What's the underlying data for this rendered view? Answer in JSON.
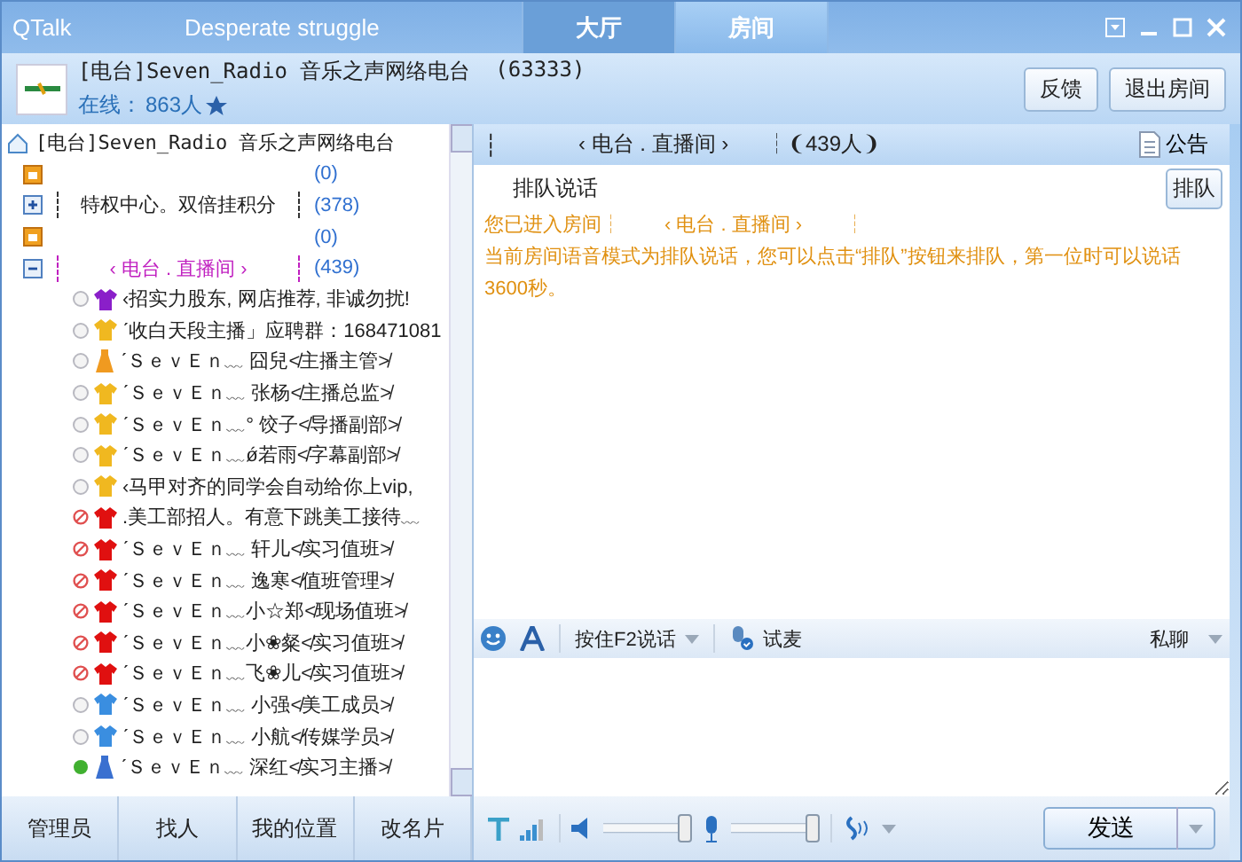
{
  "window": {
    "app": "QTalk",
    "user": "Desperate struggle",
    "tabs": [
      {
        "label": "大厅",
        "selected": false
      },
      {
        "label": "房间",
        "selected": true
      }
    ]
  },
  "header": {
    "title": "[电台]Seven_Radio 音乐之声网络电台",
    "id": "(63333)",
    "online_label": "在线：",
    "online_count": "863人",
    "buttons": [
      "反馈",
      "退出房间"
    ]
  },
  "tree": {
    "root": "[电台]Seven_Radio 音乐之声网络电台",
    "channels": [
      {
        "kind": "locked",
        "count": "(0)"
      },
      {
        "kind": "folder",
        "name": "特权中心。双倍挂积分",
        "count": "(378)",
        "expanded": false
      },
      {
        "kind": "locked",
        "count": "(0)"
      },
      {
        "kind": "folder",
        "name": "‹ 电台 . 直播间 ›",
        "count": "(439)",
        "expanded": true,
        "children": [
          {
            "name": "‹招实力股东, 网店推荐, 非诚勿扰!",
            "online": false,
            "blocked": false,
            "kind": "shirt",
            "color": "#8a1fc9"
          },
          {
            "name": "ˊ收白天段主播」应聘群：168471081",
            "online": false,
            "blocked": false,
            "kind": "shirt",
            "color": "#f0b820"
          },
          {
            "name": "ˊＳｅｖＥｎ﹏  囧兒≮主播主管≯",
            "online": false,
            "blocked": false,
            "kind": "dress",
            "color": "#f09a20"
          },
          {
            "name": "ˊＳｅｖＥｎ﹏  张杨≮主播总监≯",
            "online": false,
            "blocked": false,
            "kind": "shirt",
            "color": "#f0b820"
          },
          {
            "name": "ˊＳｅｖＥｎ﹏° 饺子≮导播副部≯",
            "online": false,
            "blocked": false,
            "kind": "shirt",
            "color": "#f0b820"
          },
          {
            "name": "ˊＳｅｖＥｎ﹏ǿ若雨≮字幕副部≯",
            "online": false,
            "blocked": false,
            "kind": "shirt",
            "color": "#f0b820"
          },
          {
            "name": "‹马甲对齐的同学会自动给你上vip,",
            "online": false,
            "blocked": false,
            "kind": "shirt",
            "color": "#f0b820"
          },
          {
            "name": ".美工部招人。有意下跳美工接待﹏",
            "online": false,
            "blocked": true,
            "kind": "shirt",
            "color": "#e01010"
          },
          {
            "name": "ˊＳｅｖＥｎ﹏  轩儿≮实习值班≯",
            "online": false,
            "blocked": true,
            "kind": "shirt",
            "color": "#e01010"
          },
          {
            "name": "ˊＳｅｖＥｎ﹏  逸寒≮值班管理≯",
            "online": false,
            "blocked": true,
            "kind": "shirt",
            "color": "#e01010"
          },
          {
            "name": "ˊＳｅｖＥｎ﹏小☆郑≮现场值班≯",
            "online": false,
            "blocked": true,
            "kind": "shirt",
            "color": "#e01010"
          },
          {
            "name": "ˊＳｅｖＥｎ﹏小❀粲≮实习值班≯",
            "online": false,
            "blocked": true,
            "kind": "shirt",
            "color": "#e01010"
          },
          {
            "name": "ˊＳｅｖＥｎ﹏飞❀儿≮实习值班≯",
            "online": false,
            "blocked": true,
            "kind": "shirt",
            "color": "#e01010"
          },
          {
            "name": "ˊＳｅｖＥｎ﹏  小强≮美工成员≯",
            "online": false,
            "blocked": false,
            "kind": "shirt",
            "color": "#3a8ee0"
          },
          {
            "name": "ˊＳｅｖＥｎ﹏  小航≮传媒学员≯",
            "online": false,
            "blocked": false,
            "kind": "shirt",
            "color": "#3a8ee0"
          },
          {
            "name": "ˊＳｅｖＥｎ﹏  深红≮实习主播≯",
            "online": true,
            "blocked": false,
            "kind": "dress",
            "color": "#3a70d0"
          }
        ]
      }
    ]
  },
  "left_buttons": [
    "管理员",
    "找人",
    "我的位置",
    "改名片"
  ],
  "room": {
    "prefix": "┆",
    "name": "‹ 电台 . 直播间 ›",
    "count": "┆❨439人❩",
    "notice": "公告",
    "mode": "排队说话",
    "queue_button": "排队",
    "messages": [
      "您已进入房间┆        ‹ 电台 . 直播间 ›        ┆",
      "当前房间语音模式为排队说话，您可以点击“排队”按钮来排队，第一位时可以说话3600秒。"
    ]
  },
  "toolbar": {
    "talk": "按住F2说话",
    "test": "试麦",
    "private": "私聊"
  },
  "bottom": {
    "speaker": {
      "level": 1.0
    },
    "mic": {
      "level": 1.0
    },
    "send": "发送"
  }
}
